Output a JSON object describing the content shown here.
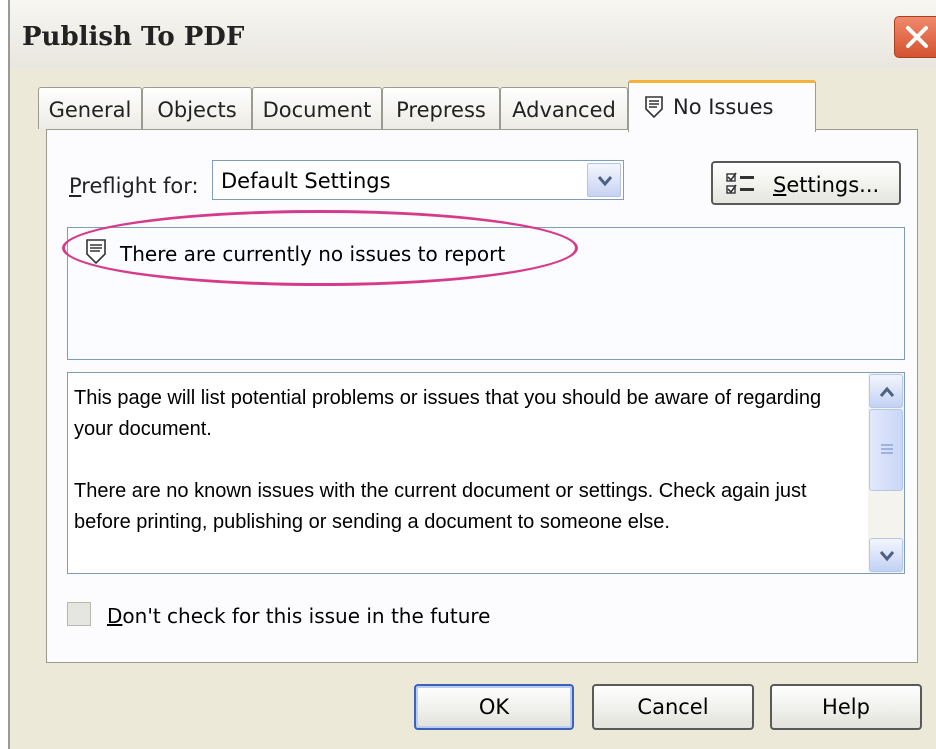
{
  "dialog": {
    "title": "Publish To PDF",
    "close_icon": "close-icon",
    "colors": {
      "background": "#ece9d8",
      "close": "#d4522f",
      "active_tab_accent": "#f7b23b",
      "highlight": "#d63a8a"
    }
  },
  "tabs": [
    {
      "label": "General"
    },
    {
      "label": "Objects"
    },
    {
      "label": "Document"
    },
    {
      "label": "Prepress"
    },
    {
      "label": "Advanced"
    },
    {
      "label": "No Issues",
      "icon": "issues-icon",
      "active": true
    }
  ],
  "preflight": {
    "label_accel": "P",
    "label_rest": "reflight for:",
    "value": "Default Settings",
    "settings_accel": "S",
    "settings_rest": "ettings..."
  },
  "issues": {
    "message": "There are currently no issues to report",
    "icon": "issues-icon"
  },
  "description": {
    "paragraph1": "This page will list potential problems or issues that you should be aware of regarding your document.",
    "paragraph2": "There are no known issues with the current document or settings. Check again just before printing, publishing or sending a document to someone else."
  },
  "checkbox": {
    "label_accel": "D",
    "label_rest": "on't check for this issue in the future",
    "checked": false
  },
  "buttons": {
    "ok": "OK",
    "cancel": "Cancel",
    "help": "Help"
  }
}
